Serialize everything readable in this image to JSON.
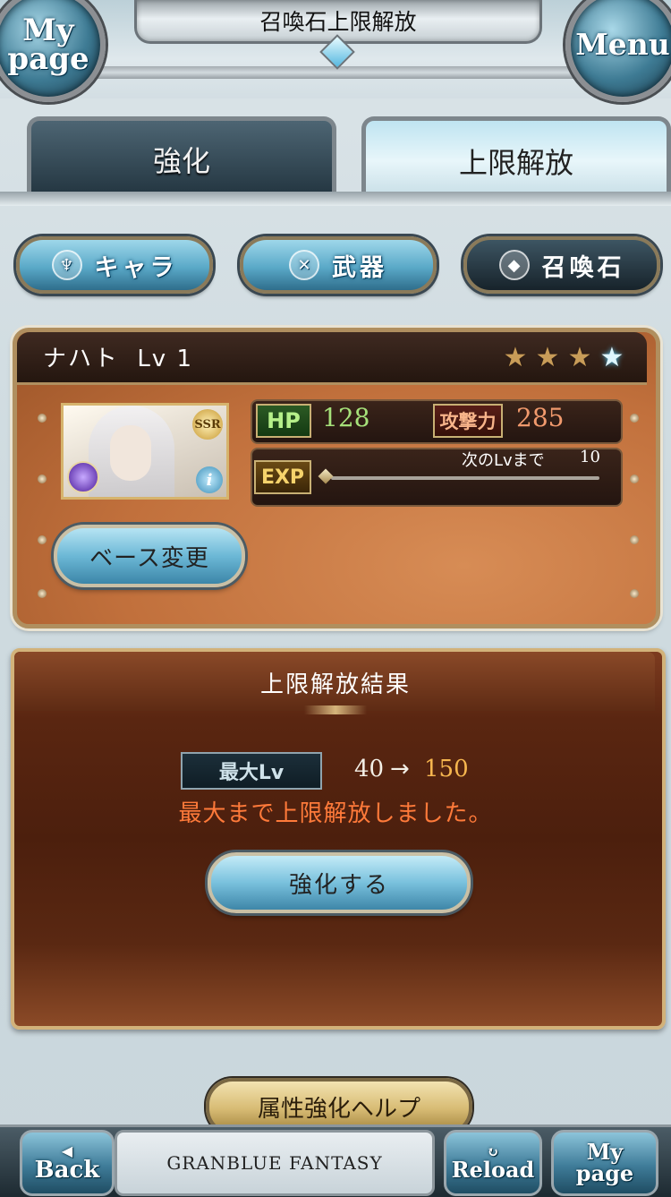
{
  "header": {
    "title": "召喚石上限解放",
    "left_orb": {
      "line1": "My",
      "line2": "page"
    },
    "right_orb": "Menu"
  },
  "tabs": [
    {
      "label": "強化",
      "active": false
    },
    {
      "label": "上限解放",
      "active": true
    }
  ],
  "categories": [
    {
      "label": "キャラ",
      "icon": "character-icon",
      "selected": false
    },
    {
      "label": "武器",
      "icon": "weapon-icon",
      "selected": false
    },
    {
      "label": "召喚石",
      "icon": "summon-crystal-icon",
      "selected": true
    }
  ],
  "summon": {
    "name": "ナハト",
    "level_label": "Lv 1",
    "rarity": "SSR",
    "stars_total": 4,
    "stars_filled": 3,
    "current_star": "4",
    "hp_label": "HP",
    "hp": "128",
    "atk_label": "攻撃力",
    "atk": "285",
    "exp_label": "EXP",
    "next_label": "次のLvまで",
    "next_value": "10",
    "exp_progress": 0.0,
    "change_base_label": "ベース変更"
  },
  "result": {
    "title": "上限解放結果",
    "max_lv_label": "最大Lv",
    "from": "40",
    "arrow": "→",
    "to": "150",
    "message": "最大まで上限解放しました。",
    "button": "強化する"
  },
  "help_button": "属性強化ヘルプ",
  "footer": {
    "back": "Back",
    "logo": "GRANBLUE FANTASY",
    "reload": "Reload",
    "mypage_line1": "My",
    "mypage_line2": "page"
  },
  "colors": {
    "hp": "#a6e17a",
    "atk": "#f19a6d",
    "max_to": "#f6b64f",
    "message": "#ff7a3a"
  }
}
